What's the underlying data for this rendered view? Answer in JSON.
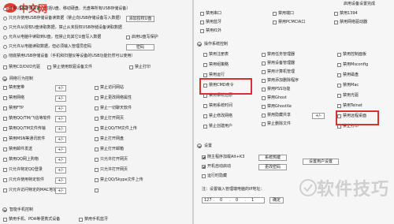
{
  "logo": {
    "text": "中文网",
    "url": "www.php.cn"
  },
  "left": {
    "top_radios": [
      {
        "label": "允许USB存储设备（包括U盘、移动硬盘、光盘等所有USB存储设备）",
        "checked": false
      },
      {
        "label": "只允许使用USB存储设备读数据（禁止向USB存储设备写入数据）",
        "checked": false,
        "button": "添加授权U盘"
      },
      {
        "label": "只允许从授权U盘读取数据，禁止从未授权USB存储设备读取数据",
        "checked": false
      },
      {
        "label": "允许从电脑中读取到U盘，但禁止向其它U盘写入数据",
        "checked": false,
        "extra_check": "启用U盘写保护"
      },
      {
        "label": "只允许从电脑读取数据，但必须输入管理员密码",
        "checked": false,
        "button": "密码"
      },
      {
        "label": "彻底禁用USB存储设备（手机和扫描仪等设备的USB功能仍然可以使用）",
        "checked": true
      }
    ],
    "row_checks": [
      {
        "label": "禁用CD/DVD光驱",
        "checked": false
      },
      {
        "label": "禁止使用软驱设备文件",
        "checked": false
      },
      {
        "label": "禁止打印",
        "checked": false
      }
    ],
    "network_section": {
      "title": "网络行为控制",
      "col1": [
        {
          "label": "禁用宽带",
          "checked": false,
          "button": "+/-"
        },
        {
          "label": "禁用网络",
          "checked": false,
          "button": "+/-"
        },
        {
          "label": "禁用FTP",
          "checked": false,
          "button": "+/-"
        },
        {
          "label": "禁用QQ/TM/飞信等软件",
          "checked": false,
          "button": "+/-"
        },
        {
          "label": "禁用QQ/TM文件传输",
          "checked": false,
          "button": "+/-"
        },
        {
          "label": "禁用MSN等通讯软件",
          "checked": false,
          "button": "+/-"
        },
        {
          "label": "禁用邮件发送",
          "checked": false,
          "button": "+/-"
        },
        {
          "label": "禁用QQ网上购物",
          "checked": false,
          "button": "+/-"
        },
        {
          "label": "只允许特定QQ登录",
          "checked": false,
          "button": "+/-"
        },
        {
          "label": "只允许使用特定软件",
          "checked": false,
          "button": "+/-"
        },
        {
          "label": "只允许访问特定的MAC地址",
          "checked": false,
          "button": "+/-"
        }
      ],
      "col2": [
        {
          "label": "禁止访问网站",
          "checked": false
        },
        {
          "label": "禁止更改网络属性",
          "checked": false
        },
        {
          "label": "禁止一切聊天软件",
          "checked": false
        },
        {
          "label": "禁止打开网页",
          "checked": false
        },
        {
          "label": "禁止QQ/TM文件上传",
          "checked": false
        },
        {
          "label": "禁止打开网盘",
          "checked": false
        },
        {
          "label": "禁止打开邮箱",
          "checked": false
        },
        {
          "label": "只允许打开网页",
          "checked": false
        },
        {
          "label": "只允许打开网页",
          "checked": false
        },
        {
          "label": "禁止QQ/Skype文件上传",
          "checked": false
        },
        {
          "label": "",
          "checked": false
        }
      ]
    },
    "bottom_section": {
      "title": "智能手机控制",
      "items": [
        {
          "label": "禁用手机、PDA等便携式设备",
          "checked": false
        },
        {
          "label": "禁用手机蓝牙",
          "checked": false
        }
      ]
    }
  },
  "right": {
    "top_checks": [
      {
        "label": "禁用串口",
        "checked": false
      },
      {
        "label": "禁用蓝牙",
        "checked": false
      },
      {
        "label": "禁用红外",
        "checked": false
      }
    ],
    "top_checks2": [
      {
        "label": "禁用端口",
        "checked": false
      },
      {
        "label": "禁用PCMCIA口",
        "checked": false
      }
    ],
    "top_checks3": [
      {
        "label": "禁用1394",
        "checked": false
      },
      {
        "label": "禁用网络驱动器",
        "checked": false
      }
    ],
    "top_link": "启用设备设置完成",
    "os_section": {
      "title": "操作系统控制",
      "col1": [
        {
          "label": "禁用注册表",
          "checked": false
        },
        {
          "label": "禁用组策略",
          "checked": false
        },
        {
          "label": "禁用运行",
          "checked": false
        },
        {
          "label": "禁用CMD命令",
          "checked": false
        },
        {
          "label": "禁用系统还原",
          "checked": false
        },
        {
          "label": "禁用系统时间",
          "checked": false
        },
        {
          "label": "禁止修改网络",
          "checked": false
        },
        {
          "label": "禁止创建用户",
          "checked": false
        }
      ],
      "col2": [
        {
          "label": "禁用任务管理器",
          "checked": false
        },
        {
          "label": "禁用设备管理器",
          "checked": false
        },
        {
          "label": "禁用计算机管理",
          "checked": false
        },
        {
          "label": "禁用添加删除程序",
          "checked": false
        },
        {
          "label": "禁用PSS功能",
          "checked": false
        },
        {
          "label": "禁用Ghost",
          "checked": false
        },
        {
          "label": "禁用GhostXe",
          "checked": false
        },
        {
          "label": "禁用隐藏共享",
          "checked": false,
          "button": "+/-"
        },
        {
          "label": "禁止删除文件",
          "checked": false
        }
      ],
      "col3": [
        {
          "label": "禁用控制面板",
          "checked": false
        },
        {
          "label": "禁用Msconfig",
          "checked": false
        },
        {
          "label": "禁用磁盘",
          "checked": false
        },
        {
          "label": "禁用Mac",
          "checked": false
        },
        {
          "label": "禁用光驱",
          "checked": false
        },
        {
          "label": "禁用Telnet",
          "checked": false
        },
        {
          "label": "禁用远程桌面",
          "checked": false
        },
        {
          "label": "禁止打印",
          "checked": false
        }
      ]
    },
    "settings_section": {
      "title": "设置",
      "items": [
        {
          "label": "随主程序加载Alt+K3",
          "checked": true,
          "button": "系统热键"
        },
        {
          "label": "开机自动启动",
          "checked": true,
          "button": "更改密码"
        },
        {
          "label": "运行时隐藏",
          "checked": false
        }
      ],
      "button_right": "设置用户设置",
      "ip_label": "注：设置输入管理端电脑的IP地址：",
      "ip_parts": [
        "127",
        "0",
        "0",
        "1"
      ],
      "ok_button": "确定"
    }
  },
  "watermark": "软件技巧"
}
